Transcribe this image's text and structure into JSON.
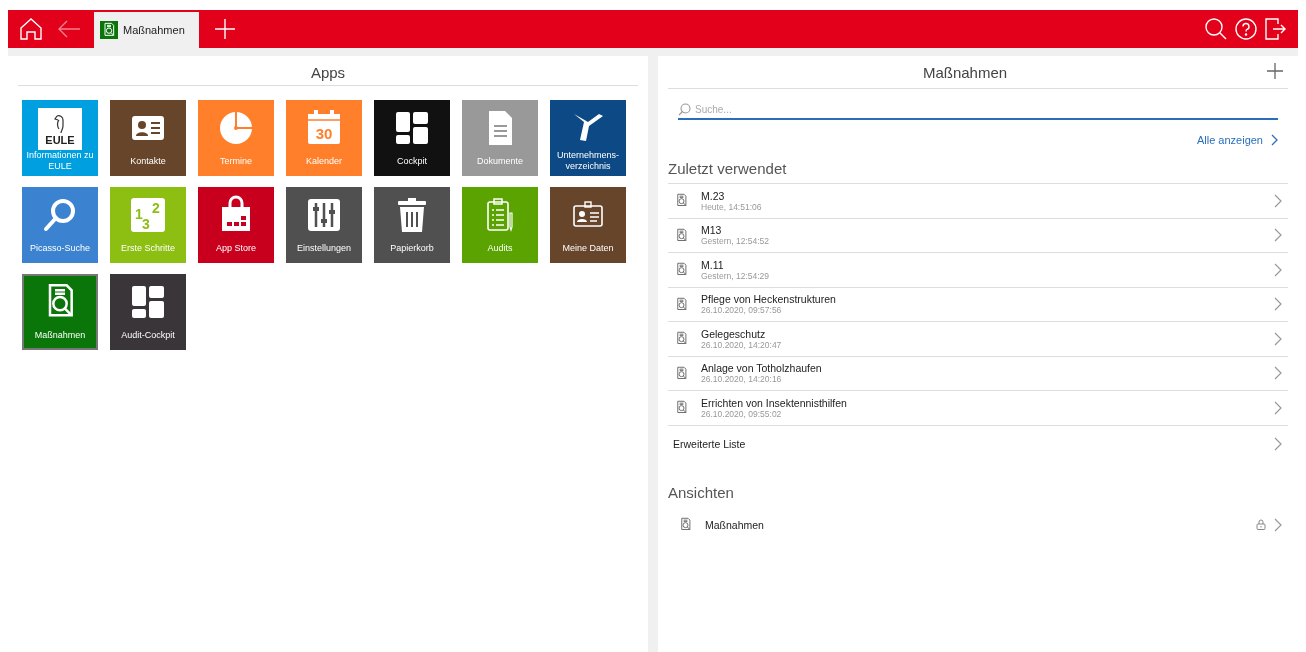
{
  "topbar": {
    "tabs": [
      {
        "label": "Maßnahmen",
        "selected": true
      }
    ],
    "back_disabled": true
  },
  "apps": {
    "title": "Apps",
    "tiles": [
      {
        "label": "Informationen zu EULE",
        "color": "#009fdf",
        "logo_text": "EULE",
        "selected": false
      },
      {
        "label": "Kontakte",
        "color": "#66452a",
        "selected": false
      },
      {
        "label": "Termine",
        "color": "#ff7f2a",
        "selected": false
      },
      {
        "label": "Kalender",
        "color": "#ff7f2a",
        "icon_text": "30",
        "selected": false
      },
      {
        "label": "Cockpit",
        "color": "#111111",
        "selected": false
      },
      {
        "label": "Dokumente",
        "color": "#999999",
        "selected": false
      },
      {
        "label": "Unternehmens-verzeichnis",
        "color": "#0d4a85",
        "selected": false
      },
      {
        "label": "Picasso-Suche",
        "color": "#3b83d1",
        "selected": false
      },
      {
        "label": "Erste Schritte",
        "color": "#8cbf12",
        "icon_digits": [
          "1",
          "3",
          "2"
        ],
        "selected": false
      },
      {
        "label": "App Store",
        "color": "#c8001e",
        "selected": false
      },
      {
        "label": "Einstellungen",
        "color": "#505050",
        "selected": false
      },
      {
        "label": "Papierkorb",
        "color": "#505050",
        "selected": false
      },
      {
        "label": "Audits",
        "color": "#5aa300",
        "selected": false
      },
      {
        "label": "Meine Daten",
        "color": "#66452a",
        "selected": false
      },
      {
        "label": "Maßnahmen",
        "color": "#0a760a",
        "selected": true
      },
      {
        "label": "Audit-Cockpit",
        "color": "#3a3539",
        "selected": false
      }
    ]
  },
  "panel": {
    "title": "Maßnahmen",
    "search": {
      "placeholder": "Suche..."
    },
    "show_all": "Alle anzeigen",
    "recent_title": "Zuletzt verwendet",
    "recent": [
      {
        "title": "M.23",
        "subtitle": "Heute, 14:51:06"
      },
      {
        "title": "M13",
        "subtitle": "Gestern, 12:54:52"
      },
      {
        "title": "M.11",
        "subtitle": "Gestern, 12:54:29"
      },
      {
        "title": "Pflege von Heckenstrukturen",
        "subtitle": "26.10.2020, 09:57:56"
      },
      {
        "title": "Gelegeschutz",
        "subtitle": "26.10.2020, 14:20:47"
      },
      {
        "title": "Anlage von Totholzhaufen",
        "subtitle": "26.10.2020, 14:20:16"
      },
      {
        "title": "Errichten von Insektennisthilfen",
        "subtitle": "26.10.2020, 09:55:02"
      }
    ],
    "extended": "Erweiterte Liste",
    "views_title": "Ansichten",
    "views": [
      {
        "title": "Maßnahmen",
        "locked": true
      }
    ]
  }
}
